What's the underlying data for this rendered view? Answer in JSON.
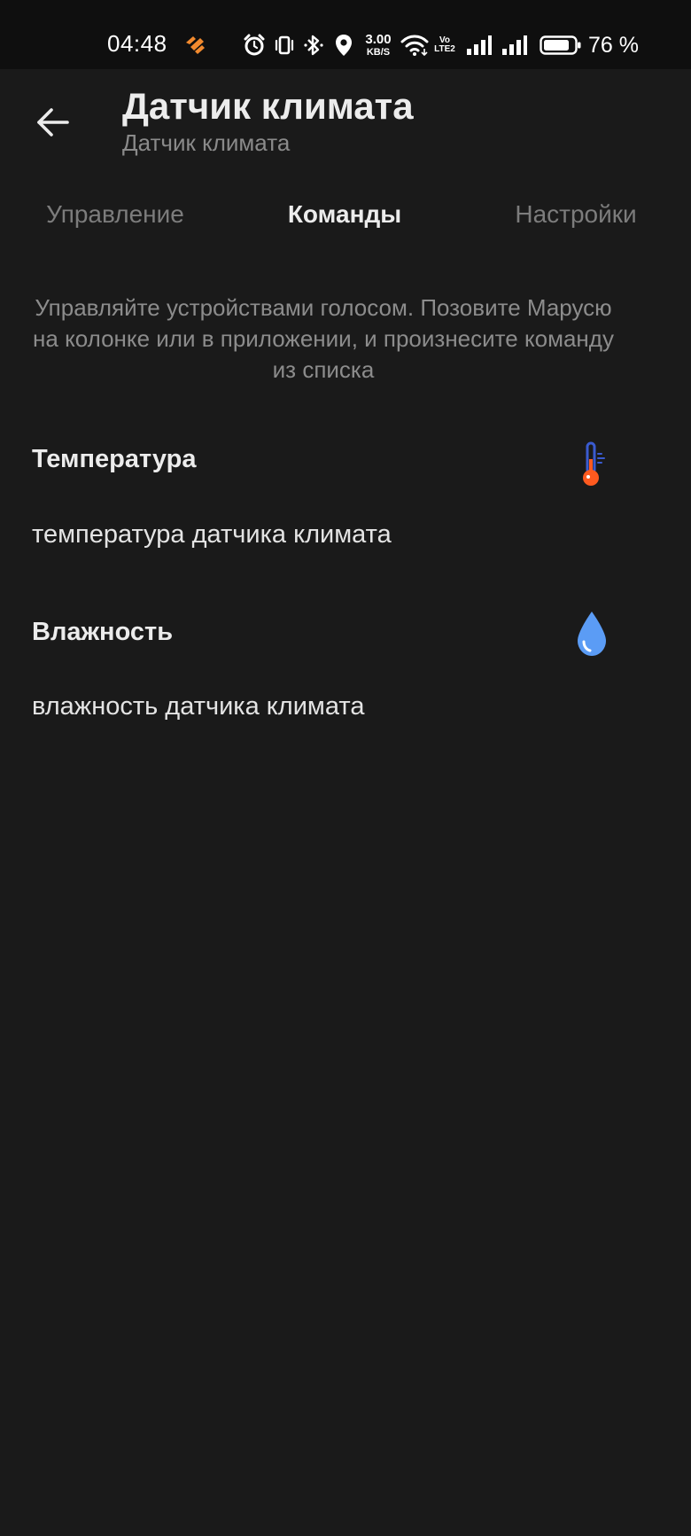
{
  "status_bar": {
    "time": "04:48",
    "net_speed_value": "3.00",
    "net_speed_unit": "KB/S",
    "volte_top": "Vo",
    "volte_bottom": "LTE2",
    "battery_percent": "76 %",
    "icons": [
      "app-notification-icon",
      "alarm-icon",
      "vibrate-icon",
      "bluetooth-icon",
      "location-icon",
      "wifi-icon",
      "volte-icon",
      "signal-sim1-icon",
      "signal-sim2-icon",
      "battery-icon"
    ]
  },
  "header": {
    "title": "Датчик климата",
    "subtitle": "Датчик климата",
    "back_icon": "arrow-left-icon"
  },
  "tabs": [
    {
      "label": "Управление",
      "active": false
    },
    {
      "label": "Команды",
      "active": true
    },
    {
      "label": "Настройки",
      "active": false
    }
  ],
  "intro": {
    "lines": [
      "Управляйте устройствами голосом. Позовите Марусю",
      "на колонке или в приложении, и произнесите команду",
      "из списка"
    ]
  },
  "commands": [
    {
      "title": "Температура",
      "icon": "thermometer-icon",
      "phrase": "температура датчика климата"
    },
    {
      "title": "Влажность",
      "icon": "water-drop-icon",
      "phrase": "влажность датчика климата"
    }
  ],
  "colors": {
    "background": "#1a1a1a",
    "status_bar": "#0f0f0f",
    "thermometer_red": "#ff5a1f",
    "thermometer_blue": "#3a5bd0",
    "drop_blue": "#5b9cf5",
    "app_icon_orange": "#f28a2e"
  }
}
